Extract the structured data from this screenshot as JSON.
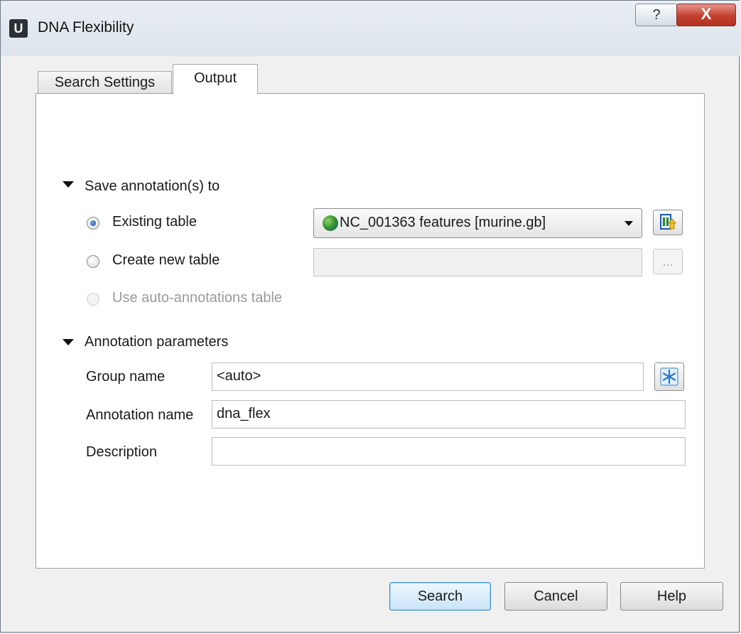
{
  "window": {
    "title": "DNA Flexibility",
    "app_icon_letter": "U",
    "help_label": "?",
    "close_label": "X"
  },
  "tabs": [
    {
      "label": "Search Settings",
      "active": false
    },
    {
      "label": "Output",
      "active": true
    }
  ],
  "save_section": {
    "label": "Save annotation(s) to",
    "options": [
      {
        "label": "Existing table",
        "checked": true,
        "enabled": true
      },
      {
        "label": "Create new table",
        "checked": false,
        "enabled": true
      },
      {
        "label": "Use auto-annotations table",
        "checked": false,
        "enabled": false
      }
    ],
    "existing_table_value": "NC_001363 features [murine.gb]",
    "new_table_path": "",
    "browse_label": "..."
  },
  "annotation_section": {
    "label": "Annotation parameters",
    "group_name_label": "Group name",
    "group_name_value": "<auto>",
    "annotation_name_label": "Annotation name",
    "annotation_name_value": "dna_flex",
    "description_label": "Description",
    "description_value": ""
  },
  "buttons": {
    "search": "Search",
    "cancel": "Cancel",
    "help": "Help"
  }
}
